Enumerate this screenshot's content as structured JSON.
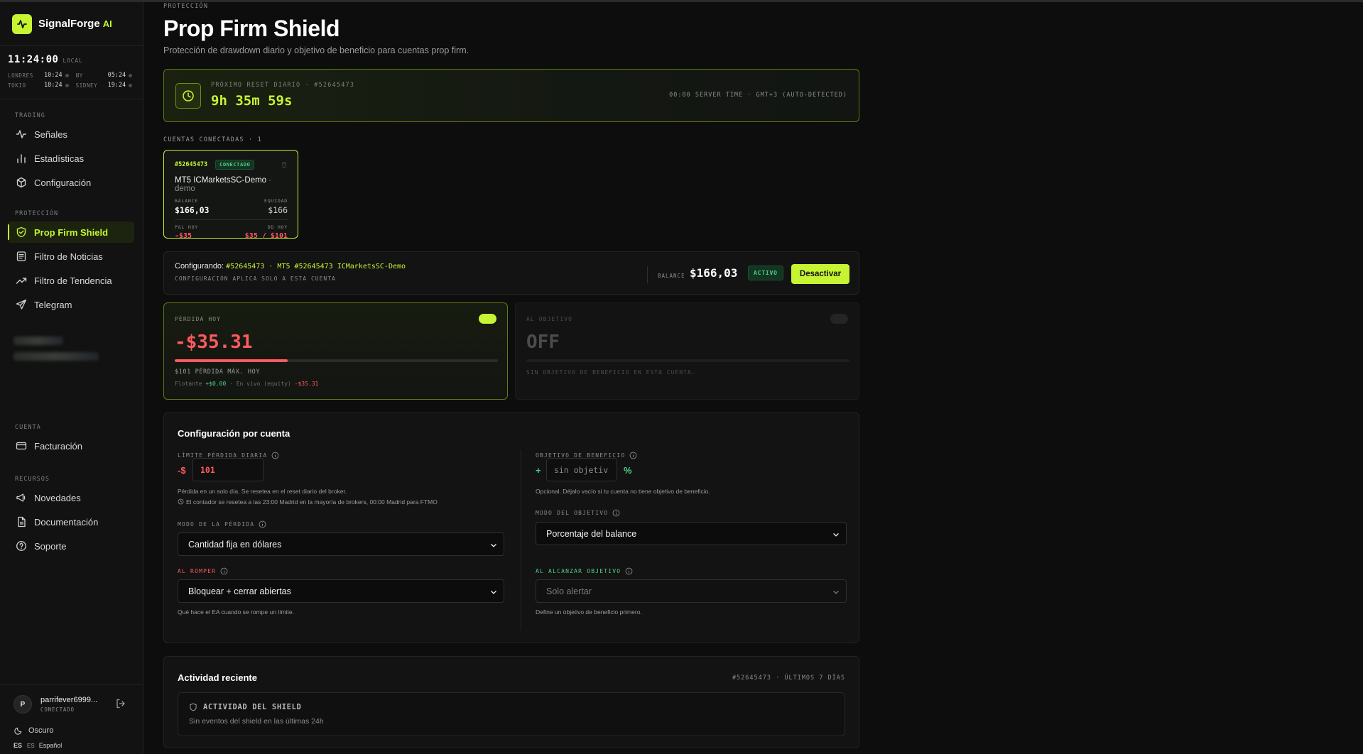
{
  "brand": {
    "name": "SignalForge",
    "suffix": "AI"
  },
  "clock": {
    "time": "11:24:00",
    "local_label": "LOCAL",
    "zones": [
      {
        "name": "LONDRES",
        "time": "10:24"
      },
      {
        "name": "NY",
        "time": "05:24"
      },
      {
        "name": "TOKIO",
        "time": "18:24"
      },
      {
        "name": "SIDNEY",
        "time": "19:24"
      }
    ]
  },
  "sidebar": {
    "sections": {
      "trading": "TRADING",
      "proteccion": "PROTECCIÓN",
      "cuenta": "CUENTA",
      "recursos": "RECURSOS"
    },
    "items": {
      "senales": "Señales",
      "estadisticas": "Estadísticas",
      "configuracion": "Configuración",
      "prop_firm_shield": "Prop Firm Shield",
      "filtro_noticias": "Filtro de Noticias",
      "filtro_tendencia": "Filtro de Tendencia",
      "telegram": "Telegram",
      "facturacion": "Facturación",
      "novedades": "Novedades",
      "documentacion": "Documentación",
      "soporte": "Soporte"
    },
    "user": {
      "initial": "P",
      "name": "parrifever6999...",
      "status": "CONECTADO"
    },
    "theme": "Oscuro",
    "lang": {
      "flag": "ES",
      "code": "ES",
      "name": "Español"
    }
  },
  "header": {
    "eyebrow": "PROTECCIÓN",
    "title": "Prop Firm Shield",
    "subtitle": "Protección de drawdown diario y objetivo de beneficio para cuentas prop firm."
  },
  "reset": {
    "label": "PRÓXIMO RESET DIARIO · #52645473",
    "countdown": "9h 35m 59s",
    "server": "00:00 SERVER TIME · GMT+3 (AUTO-DETECTED)"
  },
  "accounts": {
    "label": "CUENTAS CONECTADAS · 1",
    "card": {
      "id": "#52645473",
      "status": "CONECTADO",
      "name": "MT5 ICMarketsSC-Demo",
      "type": "· demo",
      "balance_label": "BALANCE",
      "balance": "$166,03",
      "equity_label": "EQUIDAD",
      "equity": "$166",
      "pnl_label": "P&L HOY",
      "pnl": "-$35",
      "dd_label": "DD HOY",
      "dd": "$35 / $101"
    }
  },
  "configuring": {
    "prefix": "Configurando:",
    "detail": "#52645473 · MT5 #52645473 ICMarketsSC-Demo",
    "note": "CONFIGURACIÓN APLICA SOLO A ESTA CUENTA",
    "balance_label": "BALANCE",
    "balance": "$166,03",
    "status": "ACTIVO",
    "button": "Desactivar"
  },
  "loss_card": {
    "label": "PÉRDIDA HOY",
    "value": "-$35.31",
    "progress": 0.35,
    "max_line": "$101 PÉRDIDA MÁX. HOY",
    "float_label": "Flotante",
    "float_value": "+$0.00",
    "live_label": "· En vivo (equity)",
    "live_value": "-$35.31"
  },
  "objective_card": {
    "label": "AL OBJETIVO",
    "value": "OFF",
    "note": "SIN OBJETIVO DE BENEFICIO EN ESTA CUENTA."
  },
  "settings": {
    "title": "Configuración por cuenta",
    "daily_limit": {
      "label": "LÍMITE PÉRDIDA DIARIA",
      "prefix": "-$",
      "value": "101",
      "help1": "Pérdida en un solo día. Se resetea en el reset diario del broker.",
      "help2": "El contador se resetea a las 23:00 Madrid en la mayoría de brokers, 00:00 Madrid para FTMO"
    },
    "loss_mode": {
      "label": "MODO DE LA PÉRDIDA",
      "value": "Cantidad fija en dólares"
    },
    "on_break": {
      "label": "AL ROMPER",
      "value": "Bloquear + cerrar abiertas",
      "help": "Qué hace el EA cuando se rompe un límite."
    },
    "profit_target": {
      "label": "OBJETIVO DE BENEFICIO",
      "prefix": "+",
      "placeholder": "sin objetiv",
      "suffix": "%",
      "help": "Opcional. Déjalo vacío si tu cuenta no tiene objetivo de beneficio."
    },
    "objective_mode": {
      "label": "MODO DEL OBJETIVO",
      "value": "Porcentaje del balance"
    },
    "on_target": {
      "label": "AL ALCANZAR OBJETIVO",
      "value": "Solo alertar",
      "help": "Define un objetivo de beneficio primero."
    }
  },
  "activity": {
    "title": "Actividad reciente",
    "range": "#52645473 · ÚLTIMOS 7 DÍAS",
    "box_title": "ACTIVIDAD DEL SHIELD",
    "box_sub": "Sin eventos del shield en las últimas 24h"
  },
  "colors": {
    "accent": "#c6f432",
    "danger": "#ff5a5f",
    "success": "#4fd18b",
    "bg": "#0c0d0c"
  }
}
